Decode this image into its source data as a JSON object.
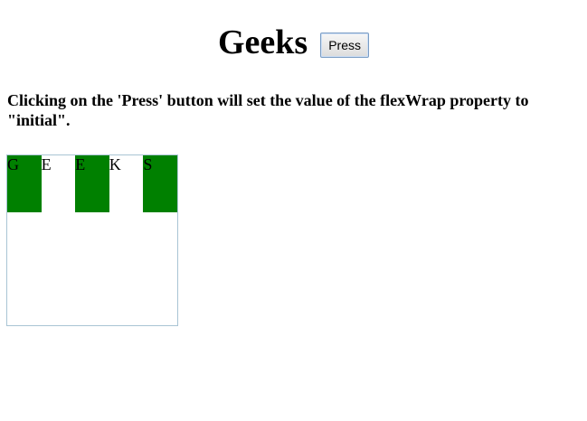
{
  "header": {
    "title": "Geeks",
    "button_label": "Press"
  },
  "description": "Clicking on the 'Press' button will set the value of the flexWrap property to \"initial\".",
  "flex_items": [
    {
      "letter": "G",
      "background": "#008000"
    },
    {
      "letter": "E",
      "background": "#ffffff"
    },
    {
      "letter": "E",
      "background": "#008000"
    },
    {
      "letter": "K",
      "background": "#ffffff"
    },
    {
      "letter": "S",
      "background": "#008000"
    }
  ]
}
